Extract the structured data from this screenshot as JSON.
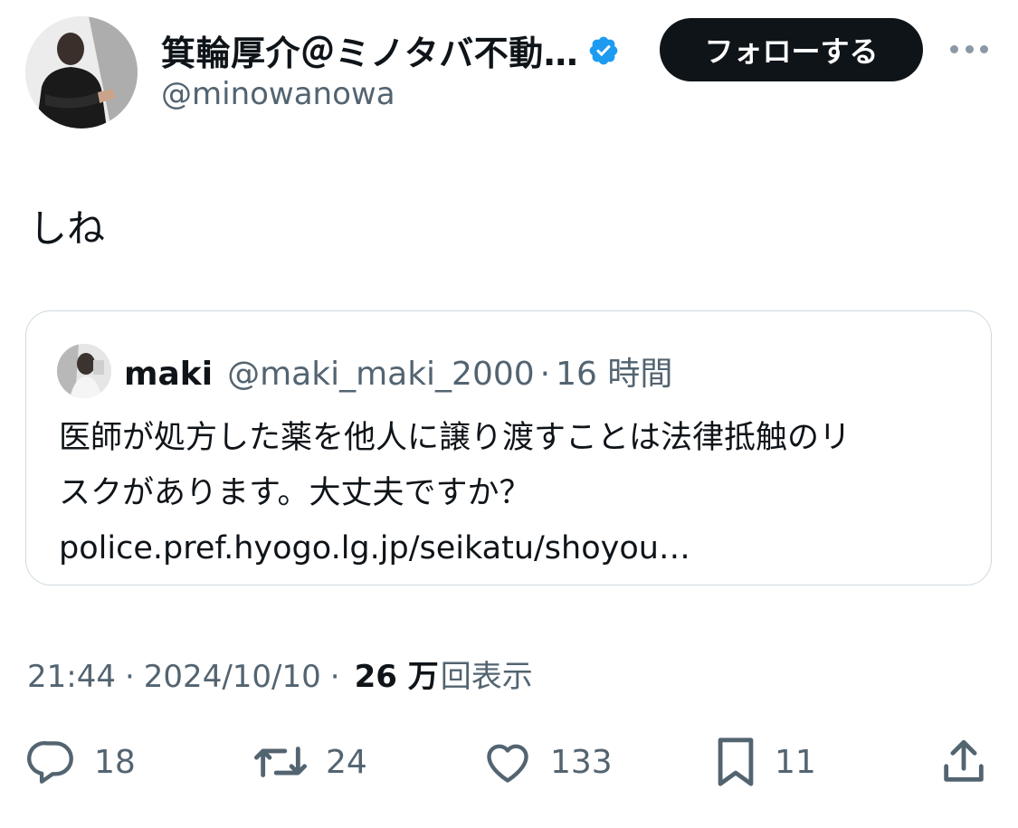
{
  "author": {
    "display_name": "箕輪厚介＠ミノタバ不動…",
    "handle": "@minowanowa",
    "verified": true,
    "avatar_icon": "profile-photo"
  },
  "header": {
    "follow_label": "フォローする",
    "more_icon": "more-horizontal-icon"
  },
  "tweet": {
    "text": "しね"
  },
  "quote": {
    "display_name": "maki",
    "handle": "@maki_maki_2000",
    "separator": "·",
    "time": "16 時間",
    "lines": [
      "医師が処方した薬を他人に譲り渡すことは法律抵触のリ",
      "スクがあります。大丈夫ですか？",
      "police.pref.hyogo.lg.jp/seikatu/shoyou…"
    ]
  },
  "meta": {
    "time": "21:44",
    "sep1": "·",
    "date": "2024/10/10",
    "sep2": "·",
    "views_count": "26 万",
    "views_label": "回表示"
  },
  "actions": {
    "replies": "18",
    "retweets": "24",
    "likes": "133",
    "bookmarks": "11"
  },
  "colors": {
    "text": "#0f1419",
    "secondary": "#536471",
    "border": "#cfd9de",
    "verified": "#1d9bf0",
    "follow_bg": "#0f1419"
  }
}
